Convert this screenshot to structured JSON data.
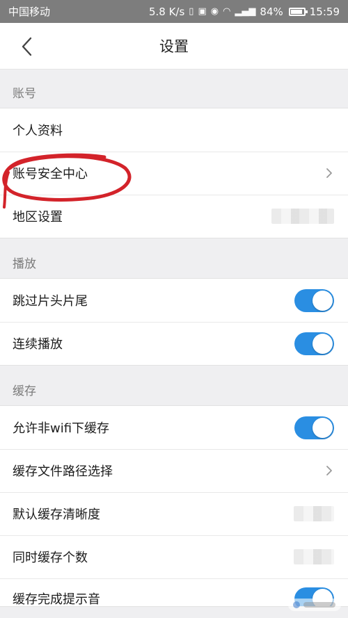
{
  "status_bar": {
    "carrier": "中国移动",
    "speed": "5.8 K/s",
    "battery": "84%",
    "time": "15:59"
  },
  "header": {
    "title": "设置",
    "back_icon": "chevron-left-icon"
  },
  "sections": [
    {
      "title": "账号",
      "rows": [
        {
          "label": "个人资料"
        },
        {
          "label": "账号安全中心",
          "accessory": "chevron-right-icon"
        },
        {
          "label": "地区设置",
          "accessory": "blurred-value"
        }
      ]
    },
    {
      "title": "播放",
      "rows": [
        {
          "label": "跳过片头片尾",
          "toggle": true
        },
        {
          "label": "连续播放",
          "toggle": true
        }
      ]
    },
    {
      "title": "缓存",
      "rows": [
        {
          "label": "允许非wifi下缓存",
          "toggle": true
        },
        {
          "label": "缓存文件路径选择",
          "accessory": "chevron-right-icon"
        },
        {
          "label": "默认缓存清晰度",
          "accessory": "blurred-value"
        },
        {
          "label": "同时缓存个数",
          "accessory": "blurred-value"
        },
        {
          "label": "缓存完成提示音",
          "toggle": true
        }
      ]
    }
  ],
  "colors": {
    "toggle_on": "#2a8ee2",
    "annotation": "#d3232a",
    "status_bar": "#7d7d7d"
  }
}
